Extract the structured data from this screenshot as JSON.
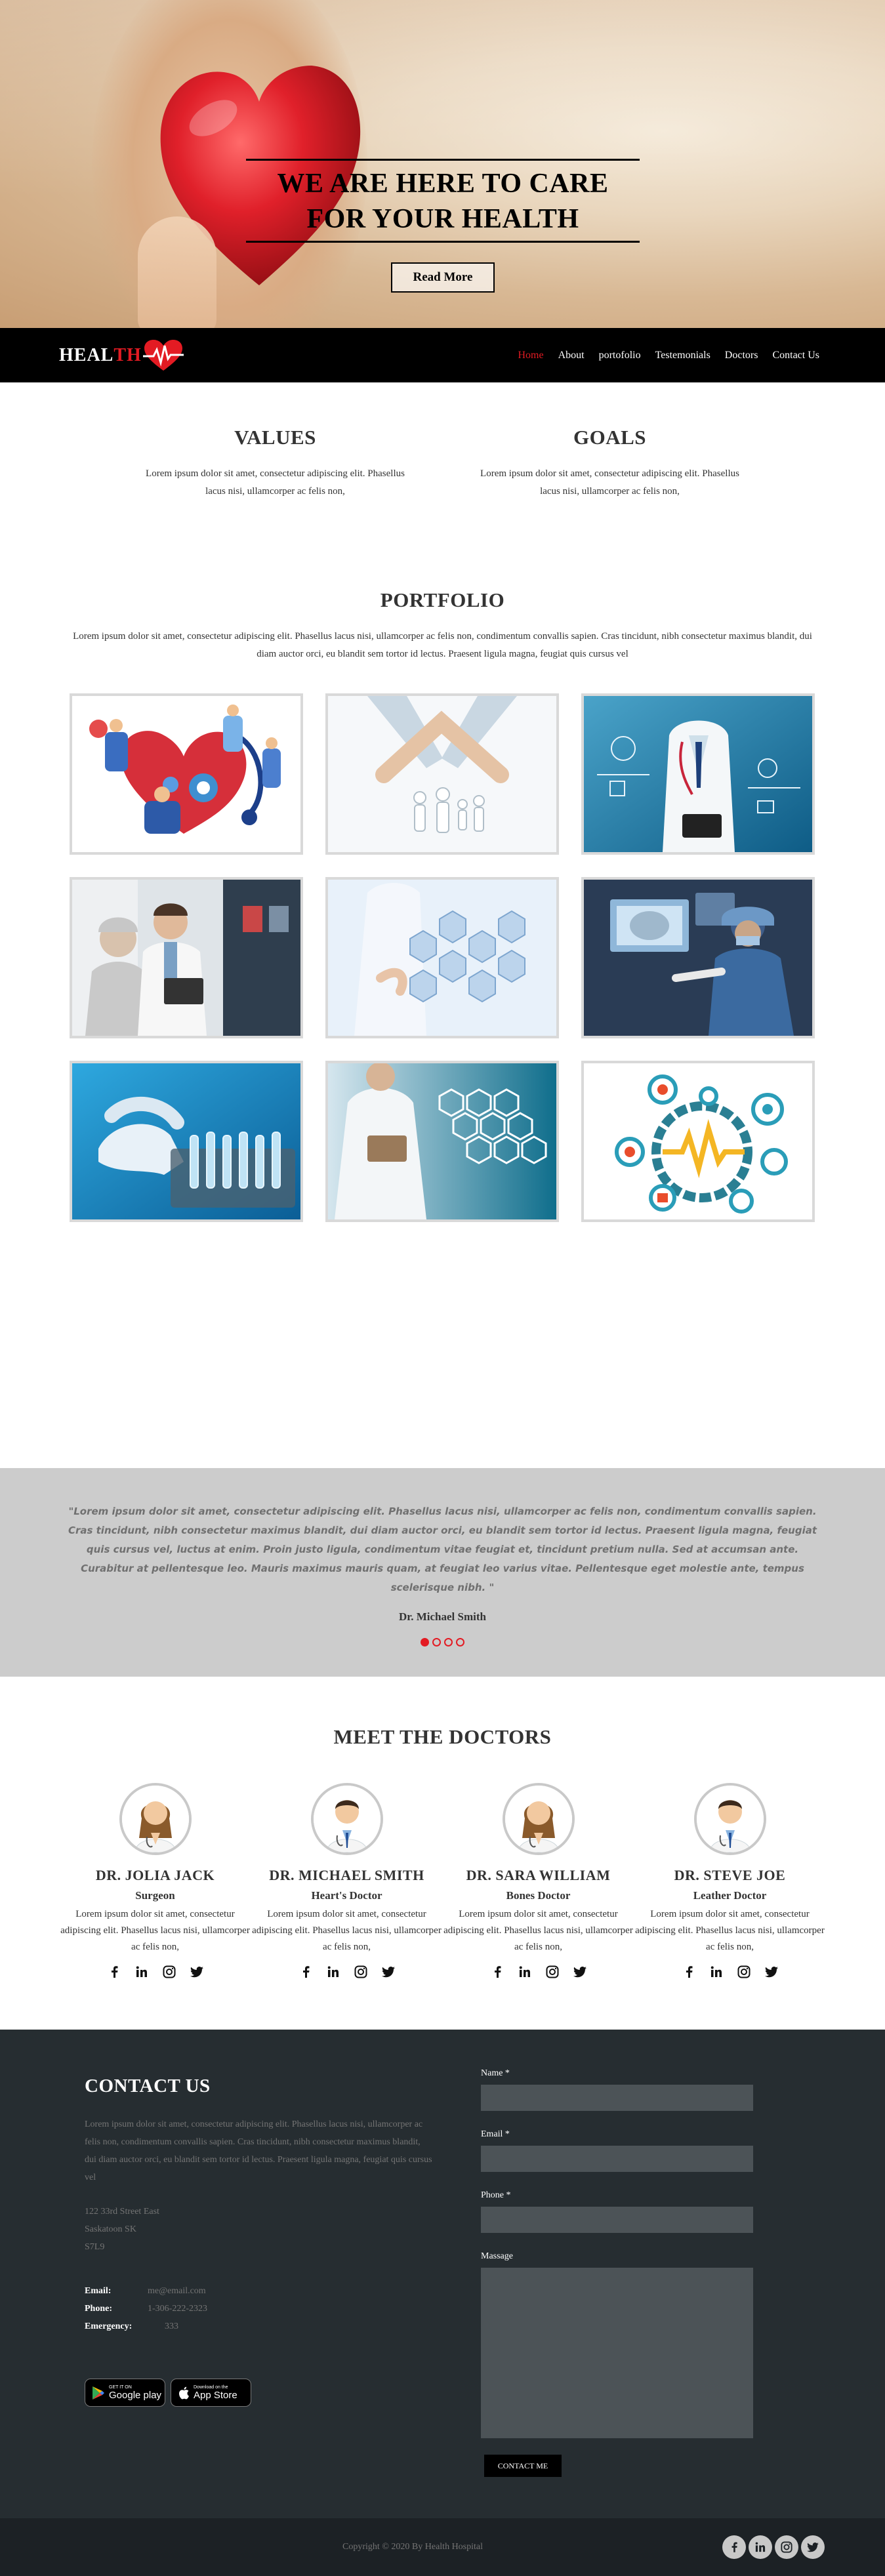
{
  "hero": {
    "title_line1": "WE ARE HERE TO CARE",
    "title_line2": "FOR YOUR HEALTH",
    "button": "Read More"
  },
  "navbar": {
    "logo_white": "HEAL",
    "logo_red": "TH",
    "items": [
      {
        "label": "Home",
        "active": true
      },
      {
        "label": "About"
      },
      {
        "label": "portofolio"
      },
      {
        "label": "Testemonials"
      },
      {
        "label": "Doctors"
      },
      {
        "label": "Contact Us"
      }
    ]
  },
  "values": {
    "values_title": "VALUES",
    "values_text": "Lorem ipsum dolor sit amet, consectetur adipiscing elit. Phasellus lacus nisi, ullamcorper ac felis non,",
    "goals_title": "GOALS",
    "goals_text": "Lorem ipsum dolor sit amet, consectetur adipiscing elit. Phasellus lacus nisi, ullamcorper ac felis non,"
  },
  "portfolio": {
    "title": "PORTFOLIO",
    "description": "Lorem ipsum dolor sit amet, consectetur adipiscing elit. Phasellus lacus nisi, ullamcorper ac felis non, condimentum convallis sapien. Cras tincidunt, nibh consectetur maximus blandit, dui diam auctor orci, eu blandit sem tortor id lectus. Praesent ligula magna, feugiat quis cursus vel",
    "images": [
      "heart-care-illustration",
      "hands-protecting-family",
      "doctor-digital-health",
      "doctor-elderly-patient",
      "medical-hexagon-icons",
      "surgeon-with-monitors",
      "lab-gloves-test-tubes",
      "doctor-tablet-icons",
      "healthcare-gears-illustration"
    ]
  },
  "testimonial": {
    "quote": "\"Lorem ipsum dolor sit amet, consectetur adipiscing elit. Phasellus lacus nisi, ullamcorper ac felis non, condimentum convallis sapien. Cras tincidunt, nibh consectetur maximus blandit, dui diam auctor orci, eu blandit sem tortor id lectus. Praesent ligula magna, feugiat quis cursus vel, luctus at enim. Proin justo ligula, condimentum vitae feugiat et, tincidunt pretium nulla. Sed at accumsan ante. Curabitur at pellentesque leo. Mauris maximus mauris quam, at feugiat leo varius vitae. Pellentesque eget molestie ante, tempus scelerisque nibh. \"",
    "author": "Dr. Michael Smith",
    "slides": 4,
    "active_slide": 1
  },
  "doctors": {
    "title": "MEET THE DOCTORS",
    "list": [
      {
        "name": "DR. JOLIA JACK",
        "specialty": "Surgeon",
        "bio": "Lorem ipsum dolor sit amet, consectetur adipiscing elit. Phasellus lacus nisi, ullamcorper ac felis non,",
        "avatar": "female-doctor-icon"
      },
      {
        "name": "DR. MICHAEL SMITH",
        "specialty": "Heart's Doctor",
        "bio": "Lorem ipsum dolor sit amet, consectetur adipiscing elit. Phasellus lacus nisi, ullamcorper ac felis non,",
        "avatar": "male-doctor-icon"
      },
      {
        "name": "DR. SARA WILLIAM",
        "specialty": "Bones Doctor",
        "bio": "Lorem ipsum dolor sit amet, consectetur adipiscing elit. Phasellus lacus nisi, ullamcorper ac felis non,",
        "avatar": "female-doctor-icon"
      },
      {
        "name": "DR. STEVE JOE",
        "specialty": "Leather Doctor",
        "bio": "Lorem ipsum dolor sit amet, consectetur adipiscing elit. Phasellus lacus nisi, ullamcorper ac felis non,",
        "avatar": "male-doctor-icon"
      }
    ]
  },
  "contact": {
    "title": "CONTACT US",
    "text": "Lorem ipsum dolor sit amet, consectetur adipiscing elit. Phasellus lacus nisi, ullamcorper ac felis non, condimentum convallis sapien. Cras tincidunt, nibh consectetur maximus blandit, dui diam auctor orci, eu blandit sem tortor id lectus. Praesent ligula magna, feugiat quis cursus vel",
    "address_line1": "122 33rd Street East",
    "address_line2": "Saskatoon SK",
    "address_line3": "S7L9",
    "email_label": "Email:",
    "email_value": "me@email.com",
    "phone_label": "Phone:",
    "phone_value": "1-306-222-2323",
    "emergency_label": "Emergency:",
    "emergency_value": "333",
    "google_play_small": "GET IT ON",
    "google_play_big": "Google play",
    "app_store_small": "Download on the",
    "app_store_big": "App Store",
    "form": {
      "name_label": "Name *",
      "email_label": "Email *",
      "phone_label": "Phone *",
      "message_label": "Massage",
      "submit": "CONTACT ME"
    }
  },
  "footer": {
    "copyright": "Copyright © 2020 By Health Hospital"
  },
  "colors": {
    "accent": "#e31b23",
    "navbar": "#000000",
    "testimonial_bg": "#cccccc",
    "contact_bg": "#262d31",
    "footer_bg": "#1c2125"
  }
}
